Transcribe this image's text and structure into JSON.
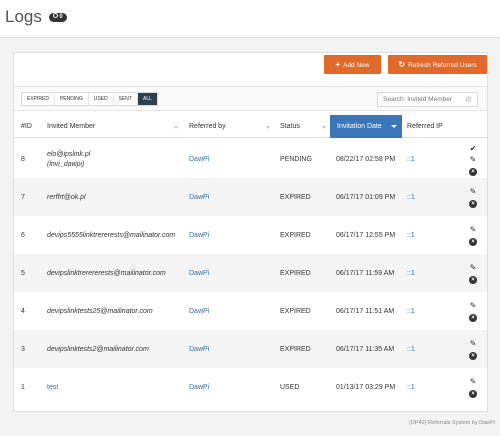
{
  "header": {
    "title": "Logs",
    "badge": "0"
  },
  "toolbar": {
    "add_new_label": "Add New",
    "refresh_label": "Refresh Referred Users"
  },
  "filters": [
    "EXPIRED",
    "PENDING",
    "USED",
    "SENT",
    "ALL"
  ],
  "active_filter": "ALL",
  "search": {
    "placeholder": "Search: Invited Member"
  },
  "columns": {
    "id": "#ID",
    "member": "Invited Member",
    "referred_by": "Referred by",
    "status": "Status",
    "date": "Invitation Date",
    "ip": "Referred IP"
  },
  "rows": [
    {
      "id": "8",
      "member_line1": "elo@ipslink.pl",
      "member_line2": "(invi_dawpi)",
      "referred_by": "DawPi",
      "status": "PENDING",
      "date": "08/22/17 02:58 PM",
      "ip": "::1",
      "member_link": false,
      "actions": [
        "check-icon",
        "pencil-icon",
        "close-icon"
      ]
    },
    {
      "id": "7",
      "member_line1": "rerffrt@ok.pl",
      "referred_by": "DawPi",
      "status": "EXPIRED",
      "date": "06/17/17 01:09 PM",
      "ip": "::1",
      "member_link": false,
      "actions": [
        "pencil-icon",
        "close-icon"
      ]
    },
    {
      "id": "6",
      "member_line1": "devips5555linktrererests@mailinator.com",
      "referred_by": "DawPi",
      "status": "EXPIRED",
      "date": "06/17/17 12:55 PM",
      "ip": "::1",
      "member_link": false,
      "actions": [
        "pencil-icon",
        "close-icon"
      ]
    },
    {
      "id": "5",
      "member_line1": "devipslinktrerererests@mailinator.com",
      "referred_by": "DawPi",
      "status": "EXPIRED",
      "date": "06/17/17 11:59 AM",
      "ip": "::1",
      "member_link": false,
      "actions": [
        "pencil-icon",
        "close-icon"
      ]
    },
    {
      "id": "4",
      "member_line1": "devipslinktests25@mailinator.com",
      "referred_by": "DawPi",
      "status": "EXPIRED",
      "date": "06/17/17 11:51 AM",
      "ip": "::1",
      "member_link": false,
      "actions": [
        "pencil-icon",
        "close-icon"
      ]
    },
    {
      "id": "3",
      "member_line1": "devipslinktests2@mailinator.com",
      "referred_by": "DawPi",
      "status": "EXPIRED",
      "date": "06/17/17 11:35 AM",
      "ip": "::1",
      "member_link": false,
      "actions": [
        "pencil-icon",
        "close-icon"
      ]
    },
    {
      "id": "1",
      "member_line1": "test",
      "referred_by": "DawPi",
      "status": "USED",
      "date": "01/13/17 03:29 PM",
      "ip": "::1",
      "member_link": true,
      "actions": [
        "pencil-icon",
        "close-icon"
      ]
    }
  ],
  "footer": {
    "text": "(DP42) Referrals System by DawPi"
  },
  "colors": {
    "accent": "#e06a2b",
    "active_header": "#3b77b8",
    "active_filter": "#2d3e50",
    "link": "#2f6ea8"
  }
}
